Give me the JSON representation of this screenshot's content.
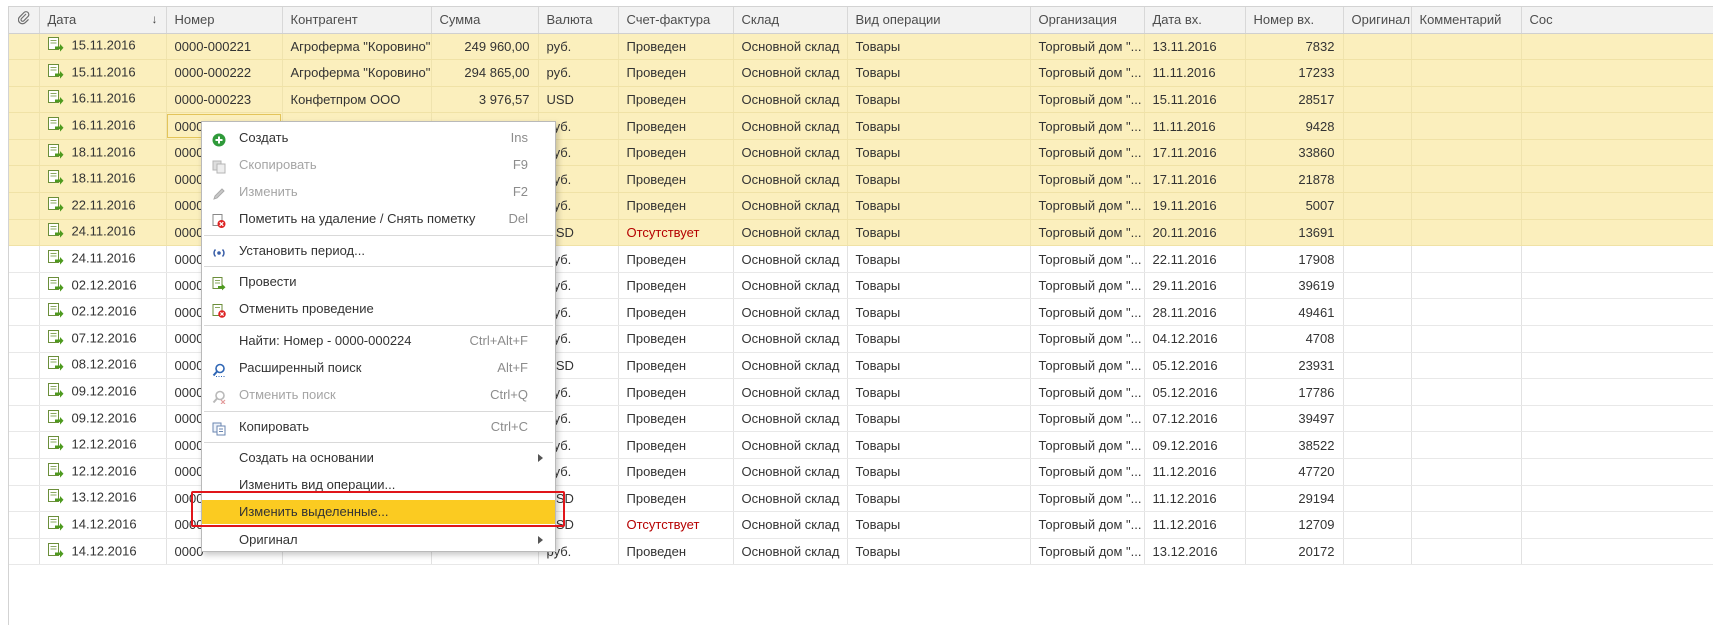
{
  "table": {
    "columns": [
      {
        "key": "attach",
        "label": ""
      },
      {
        "key": "date",
        "label": "Дата",
        "sort": "↓"
      },
      {
        "key": "number",
        "label": "Номер"
      },
      {
        "key": "contractor",
        "label": "Контрагент"
      },
      {
        "key": "sum",
        "label": "Сумма"
      },
      {
        "key": "currency",
        "label": "Валюта"
      },
      {
        "key": "invoice",
        "label": "Счет-фактура"
      },
      {
        "key": "warehouse",
        "label": "Склад"
      },
      {
        "key": "operation",
        "label": "Вид операции"
      },
      {
        "key": "organization",
        "label": "Организация"
      },
      {
        "key": "date_in",
        "label": "Дата вх."
      },
      {
        "key": "number_in",
        "label": "Номер вх."
      },
      {
        "key": "original",
        "label": "Оригинал"
      },
      {
        "key": "comment",
        "label": "Комментарий"
      },
      {
        "key": "extra",
        "label": "Сос"
      }
    ],
    "rows": [
      {
        "selected": true,
        "date": "15.11.2016",
        "number": "0000-000221",
        "contractor": "Агроферма \"Коровино\"",
        "sum": "249 960,00",
        "currency": "руб.",
        "invoice": "Проведен",
        "warehouse": "Основной склад",
        "operation": "Товары",
        "organization": "Торговый дом \"...",
        "date_in": "13.11.2016",
        "number_in": "7832"
      },
      {
        "selected": true,
        "date": "15.11.2016",
        "number": "0000-000222",
        "contractor": "Агроферма \"Коровино\"",
        "sum": "294 865,00",
        "currency": "руб.",
        "invoice": "Проведен",
        "warehouse": "Основной склад",
        "operation": "Товары",
        "organization": "Торговый дом \"...",
        "date_in": "11.11.2016",
        "number_in": "17233"
      },
      {
        "selected": true,
        "date": "16.11.2016",
        "number": "0000-000223",
        "contractor": "Конфетпром ООО",
        "sum": "3 976,57",
        "currency": "USD",
        "invoice": "Проведен",
        "warehouse": "Основной склад",
        "operation": "Товары",
        "organization": "Торговый дом \"...",
        "date_in": "15.11.2016",
        "number_in": "28517"
      },
      {
        "selected": true,
        "current": true,
        "date": "16.11.2016",
        "number": "0000",
        "contractor": "",
        "sum": "",
        "currency": "руб.",
        "invoice": "Проведен",
        "warehouse": "Основной склад",
        "operation": "Товары",
        "organization": "Торговый дом \"...",
        "date_in": "11.11.2016",
        "number_in": "9428"
      },
      {
        "selected": true,
        "date": "18.11.2016",
        "number": "0000",
        "contractor": "",
        "sum": "",
        "currency": "руб.",
        "invoice": "Проведен",
        "warehouse": "Основной склад",
        "operation": "Товары",
        "organization": "Торговый дом \"...",
        "date_in": "17.11.2016",
        "number_in": "33860"
      },
      {
        "selected": true,
        "date": "18.11.2016",
        "number": "0000",
        "contractor": "",
        "sum": "",
        "currency": "руб.",
        "invoice": "Проведен",
        "warehouse": "Основной склад",
        "operation": "Товары",
        "organization": "Торговый дом \"...",
        "date_in": "17.11.2016",
        "number_in": "21878"
      },
      {
        "selected": true,
        "date": "22.11.2016",
        "number": "0000",
        "contractor": "",
        "sum": "",
        "currency": "руб.",
        "invoice": "Проведен",
        "warehouse": "Основной склад",
        "operation": "Товары",
        "organization": "Торговый дом \"...",
        "date_in": "19.11.2016",
        "number_in": "5007"
      },
      {
        "selected": true,
        "date": "24.11.2016",
        "number": "0000",
        "contractor": "",
        "sum": "",
        "currency": "USD",
        "invoice": "Отсутствует",
        "invoice_missing": true,
        "warehouse": "Основной склад",
        "operation": "Товары",
        "organization": "Торговый дом \"...",
        "date_in": "20.11.2016",
        "number_in": "13691"
      },
      {
        "selected": false,
        "date": "24.11.2016",
        "number": "0000",
        "contractor": "",
        "sum": "",
        "currency": "руб.",
        "invoice": "Проведен",
        "warehouse": "Основной склад",
        "operation": "Товары",
        "organization": "Торговый дом \"...",
        "date_in": "22.11.2016",
        "number_in": "17908"
      },
      {
        "selected": false,
        "date": "02.12.2016",
        "number": "0000",
        "contractor": "",
        "sum": "",
        "currency": "руб.",
        "invoice": "Проведен",
        "warehouse": "Основной склад",
        "operation": "Товары",
        "organization": "Торговый дом \"...",
        "date_in": "29.11.2016",
        "number_in": "39619"
      },
      {
        "selected": false,
        "date": "02.12.2016",
        "number": "0000",
        "contractor": "",
        "sum": "",
        "currency": "руб.",
        "invoice": "Проведен",
        "warehouse": "Основной склад",
        "operation": "Товары",
        "organization": "Торговый дом \"...",
        "date_in": "28.11.2016",
        "number_in": "49461"
      },
      {
        "selected": false,
        "date": "07.12.2016",
        "number": "0000",
        "contractor": "",
        "sum": "",
        "currency": "руб.",
        "invoice": "Проведен",
        "warehouse": "Основной склад",
        "operation": "Товары",
        "organization": "Торговый дом \"...",
        "date_in": "04.12.2016",
        "number_in": "4708"
      },
      {
        "selected": false,
        "date": "08.12.2016",
        "number": "0000",
        "contractor": "",
        "sum": "",
        "currency": "USD",
        "invoice": "Проведен",
        "warehouse": "Основной склад",
        "operation": "Товары",
        "organization": "Торговый дом \"...",
        "date_in": "05.12.2016",
        "number_in": "23931"
      },
      {
        "selected": false,
        "date": "09.12.2016",
        "number": "0000",
        "contractor": "",
        "sum": "",
        "currency": "руб.",
        "invoice": "Проведен",
        "warehouse": "Основной склад",
        "operation": "Товары",
        "organization": "Торговый дом \"...",
        "date_in": "05.12.2016",
        "number_in": "17786"
      },
      {
        "selected": false,
        "date": "09.12.2016",
        "number": "0000",
        "contractor": "",
        "sum": "",
        "currency": "руб.",
        "invoice": "Проведен",
        "warehouse": "Основной склад",
        "operation": "Товары",
        "organization": "Торговый дом \"...",
        "date_in": "07.12.2016",
        "number_in": "39497"
      },
      {
        "selected": false,
        "date": "12.12.2016",
        "number": "0000",
        "contractor": "",
        "sum": "",
        "currency": "руб.",
        "invoice": "Проведен",
        "warehouse": "Основной склад",
        "operation": "Товары",
        "organization": "Торговый дом \"...",
        "date_in": "09.12.2016",
        "number_in": "38522"
      },
      {
        "selected": false,
        "date": "12.12.2016",
        "number": "0000",
        "contractor": "",
        "sum": "",
        "currency": "руб.",
        "invoice": "Проведен",
        "warehouse": "Основной склад",
        "operation": "Товары",
        "organization": "Торговый дом \"...",
        "date_in": "11.12.2016",
        "number_in": "47720"
      },
      {
        "selected": false,
        "date": "13.12.2016",
        "number": "0000",
        "contractor": "",
        "sum": "",
        "currency": "USD",
        "invoice": "Проведен",
        "warehouse": "Основной склад",
        "operation": "Товары",
        "organization": "Торговый дом \"...",
        "date_in": "11.12.2016",
        "number_in": "29194"
      },
      {
        "selected": false,
        "date": "14.12.2016",
        "number": "0000",
        "contractor": "",
        "sum": "",
        "currency": "USD",
        "invoice": "Отсутствует",
        "invoice_missing": true,
        "warehouse": "Основной склад",
        "operation": "Товары",
        "organization": "Торговый дом \"...",
        "date_in": "11.12.2016",
        "number_in": "12709"
      },
      {
        "selected": false,
        "date": "14.12.2016",
        "number": "0000",
        "contractor": "",
        "sum": "",
        "currency": "руб.",
        "invoice": "Проведен",
        "warehouse": "Основной склад",
        "operation": "Товары",
        "organization": "Торговый дом \"...",
        "date_in": "13.12.2016",
        "number_in": "20172"
      }
    ]
  },
  "context_menu": {
    "items": [
      {
        "type": "item",
        "id": "create",
        "icon": "plus-circle-icon",
        "label": "Создать",
        "shortcut": "Ins"
      },
      {
        "type": "item",
        "id": "copy-item",
        "icon": "copy-doc-icon",
        "label": "Скопировать",
        "shortcut": "F9",
        "disabled": true
      },
      {
        "type": "item",
        "id": "edit",
        "icon": "pencil-icon",
        "label": "Изменить",
        "shortcut": "F2",
        "disabled": true
      },
      {
        "type": "item",
        "id": "mark-delete",
        "icon": "delete-mark-icon",
        "label": "Пометить на удаление / Снять пометку",
        "shortcut": "Del"
      },
      {
        "type": "sep"
      },
      {
        "type": "item",
        "id": "set-period",
        "icon": "period-icon",
        "label": "Установить период..."
      },
      {
        "type": "sep"
      },
      {
        "type": "item",
        "id": "post",
        "icon": "post-doc-icon",
        "label": "Провести"
      },
      {
        "type": "item",
        "id": "unpost",
        "icon": "unpost-doc-icon",
        "label": "Отменить проведение"
      },
      {
        "type": "sep"
      },
      {
        "type": "item",
        "id": "find",
        "icon": "",
        "label": "Найти: Номер - 0000-000224",
        "shortcut": "Ctrl+Alt+F"
      },
      {
        "type": "item",
        "id": "advanced-search",
        "icon": "search-icon",
        "label": "Расширенный поиск",
        "shortcut": "Alt+F"
      },
      {
        "type": "item",
        "id": "cancel-search",
        "icon": "search-cancel-icon",
        "label": "Отменить поиск",
        "shortcut": "Ctrl+Q",
        "disabled": true
      },
      {
        "type": "sep"
      },
      {
        "type": "item",
        "id": "copy-clipboard",
        "icon": "clipboard-copy-icon",
        "label": "Копировать",
        "shortcut": "Ctrl+C"
      },
      {
        "type": "sep"
      },
      {
        "type": "item",
        "id": "create-based",
        "icon": "",
        "label": "Создать на основании",
        "submenu": true
      },
      {
        "type": "item",
        "id": "change-op",
        "icon": "",
        "label": "Изменить вид операции..."
      },
      {
        "type": "item",
        "id": "change-selected",
        "icon": "",
        "label": "Изменить выделенные...",
        "highlighted": true
      },
      {
        "type": "item",
        "id": "original",
        "icon": "",
        "label": "Оригинал",
        "submenu": true
      }
    ]
  },
  "colors": {
    "selected_row": "#fbefbd",
    "highlighted_item": "#fbcb21",
    "annotation_box": "#e0151a",
    "status_missing": "#b50000"
  }
}
